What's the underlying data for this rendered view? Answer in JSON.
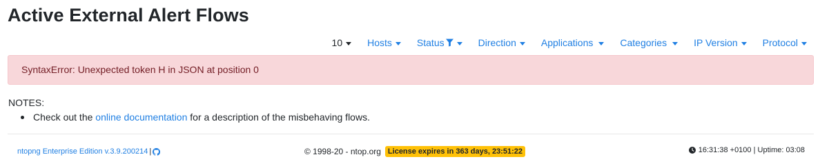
{
  "page": {
    "title": "Active External Alert Flows"
  },
  "toolbar": {
    "page_size": "10",
    "hosts": "Hosts",
    "status": "Status",
    "direction": "Direction",
    "applications": "Applications",
    "categories": "Categories",
    "ip_version": "IP Version",
    "protocol": "Protocol"
  },
  "alert": {
    "message": "SyntaxError: Unexpected token H in JSON at position 0"
  },
  "notes": {
    "heading": "NOTES:",
    "item_prefix": "Check out the",
    "item_link": "online documentation",
    "item_suffix": "for a description of the misbehaving flows."
  },
  "footer": {
    "edition": "ntopng Enterprise Edition v.3.9.200214",
    "separator": "|",
    "copyright": "© 1998-20 - ntop.org",
    "license": "License expires in 363 days, 23:51:22",
    "clock": "16:31:38 +0100 | Uptime: 03:08"
  },
  "colors": {
    "link": "#1f7fe3",
    "alert_bg": "#f8d7da",
    "alert_text": "#721c24",
    "badge": "#ffc107"
  }
}
